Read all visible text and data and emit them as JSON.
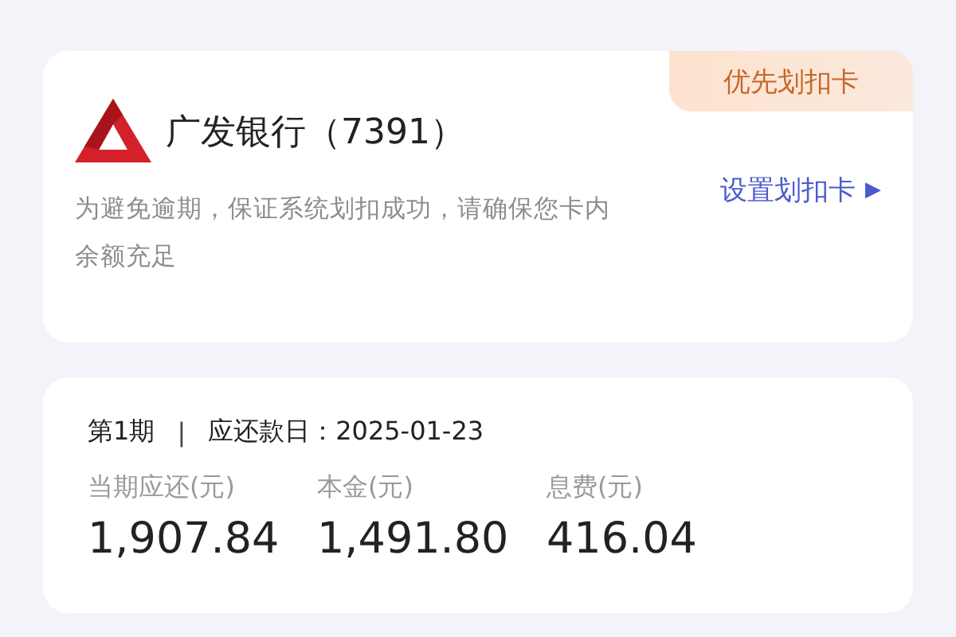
{
  "card": {
    "badge": "优先划扣卡",
    "bank_name": "广发银行（7391）",
    "notice": "为避免逾期，保证系统划扣成功，请确保您卡内余额充足",
    "link": "设置划扣卡",
    "link_arrow": "▶"
  },
  "schedule": {
    "period": "第1期",
    "separator": "|",
    "due_label": "应还款日：2025-01-23",
    "amounts": [
      {
        "label": "当期应还(元)",
        "value": "1,907.84"
      },
      {
        "label": "本金(元)",
        "value": "1,491.80"
      },
      {
        "label": "息费(元)",
        "value": "416.04"
      }
    ]
  }
}
